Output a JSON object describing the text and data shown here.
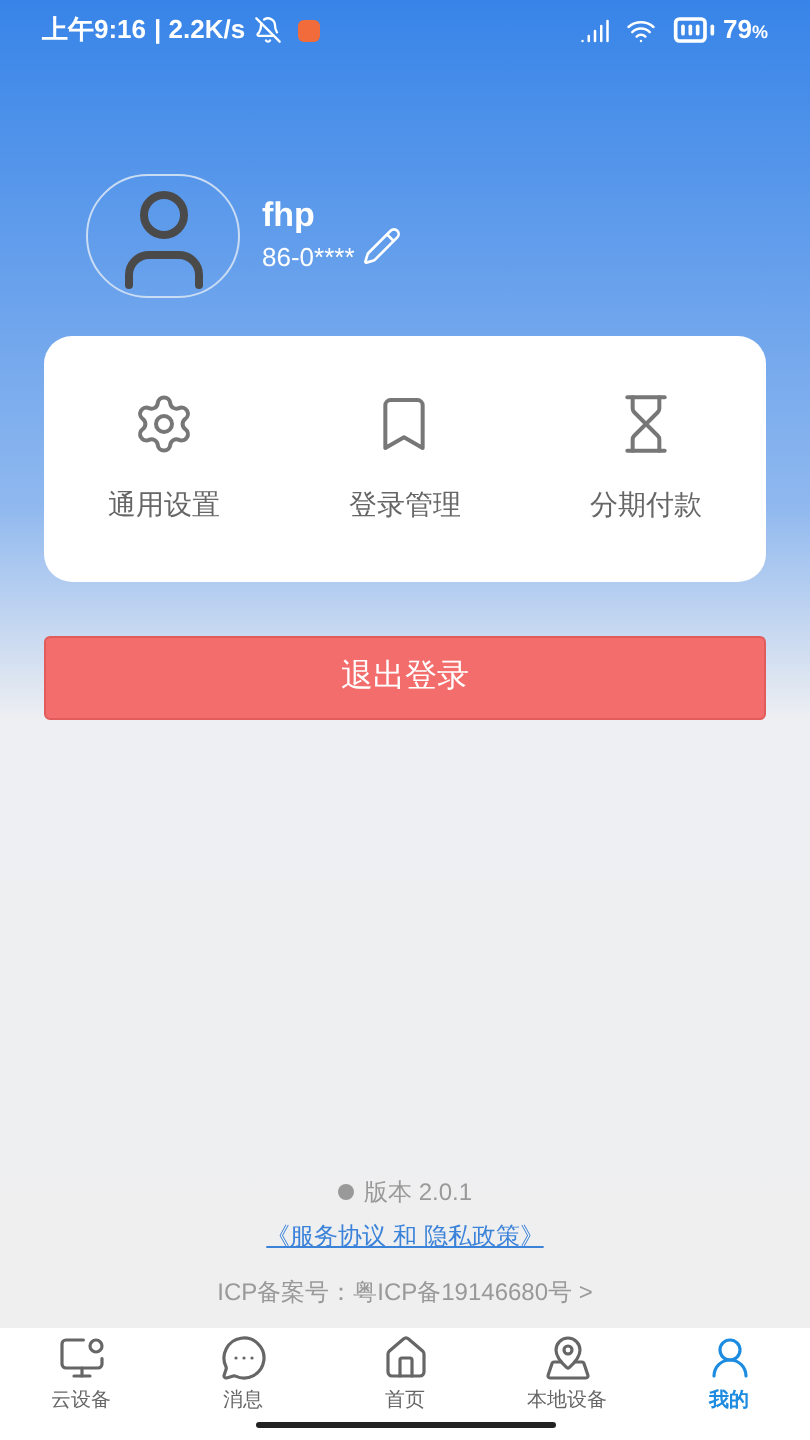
{
  "status_bar": {
    "time": "上午9:16",
    "speed": "| 2.2K/s",
    "battery": "79",
    "battery_unit": "%"
  },
  "profile": {
    "name": "fhp",
    "phone": "86-0****"
  },
  "shortcuts": [
    {
      "label": "通用设置",
      "kind": "settings"
    },
    {
      "label": "登录管理",
      "kind": "bookmark"
    },
    {
      "label": "分期付款",
      "kind": "hourglass"
    }
  ],
  "logout_button": "退出登录",
  "footer": {
    "version": "版本 2.0.1",
    "agreement_link": "《服务协议 和 隐私政策》",
    "icp": "ICP备案号：粤ICP备19146680号 >"
  },
  "tabs": [
    {
      "label": "云设备",
      "kind": "cloud",
      "selected": false
    },
    {
      "label": "消息",
      "kind": "message",
      "selected": false
    },
    {
      "label": "首页",
      "kind": "home",
      "selected": false
    },
    {
      "label": "本地设备",
      "kind": "local",
      "selected": false
    },
    {
      "label": "我的",
      "kind": "me",
      "selected": true
    }
  ]
}
